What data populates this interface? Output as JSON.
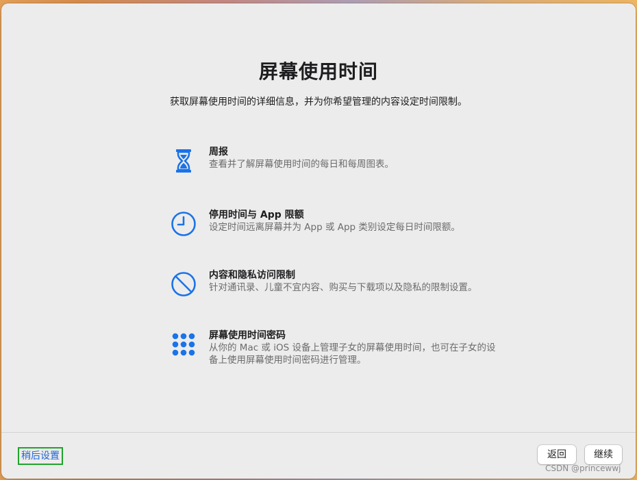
{
  "title": "屏幕使用时间",
  "subtitle": "获取屏幕使用时间的详细信息，并为你希望管理的内容设定时间限制。",
  "features": [
    {
      "icon": "hourglass-icon",
      "title": "周报",
      "description": "查看并了解屏幕使用时间的每日和每周图表。"
    },
    {
      "icon": "clock-icon",
      "title": "停用时间与 App 限额",
      "description": "设定时间远离屏幕并为 App 或 App 类别设定每日时间限额。"
    },
    {
      "icon": "prohibited-icon",
      "title": "内容和隐私访问限制",
      "description": "针对通讯录、儿童不宜内容、购买与下载项以及隐私的限制设置。"
    },
    {
      "icon": "keypad-icon",
      "title": "屏幕使用时间密码",
      "description": "从你的 Mac 或 iOS 设备上管理子女的屏幕使用时间，也可在子女的设备上使用屏幕使用时间密码进行管理。"
    }
  ],
  "footer": {
    "later_label": "稍后设置",
    "back_label": "返回",
    "continue_label": "继续"
  },
  "watermark": "CSDN @princewwj",
  "colors": {
    "accent": "#1f67d6",
    "icon": "#1a73e8",
    "window_bg": "#ececec",
    "highlight_border": "#1fa32b"
  }
}
